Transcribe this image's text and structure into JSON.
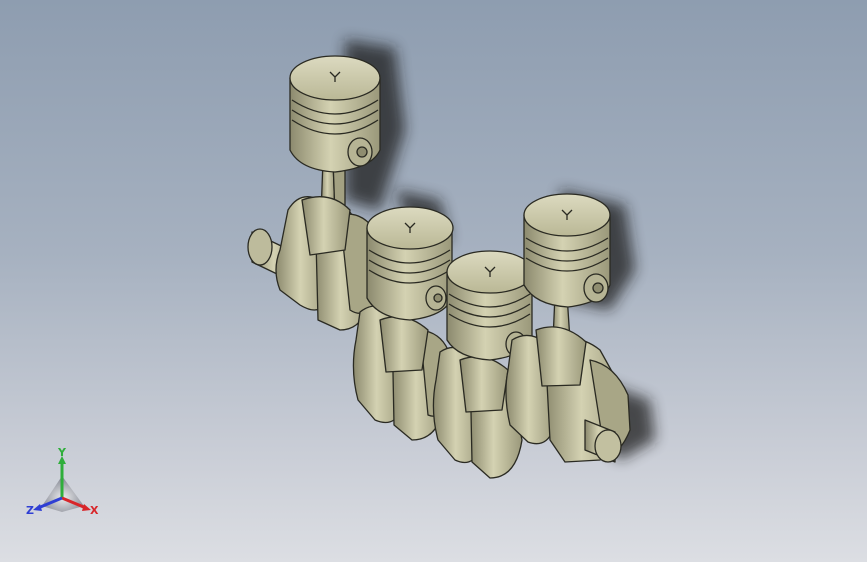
{
  "viewport": {
    "background_top": "#8e9db0",
    "background_bottom": "#dcdee3",
    "model": {
      "name": "crankshaft-piston-assembly",
      "piston_count": 4,
      "part_color": "#c8c6a6",
      "edge_color": "#2a2a22"
    }
  },
  "triad": {
    "x_label": "X",
    "y_label": "Y",
    "z_label": "Z",
    "x_color": "#d8262a",
    "y_color": "#2fae3b",
    "z_color": "#2f3fd4"
  }
}
